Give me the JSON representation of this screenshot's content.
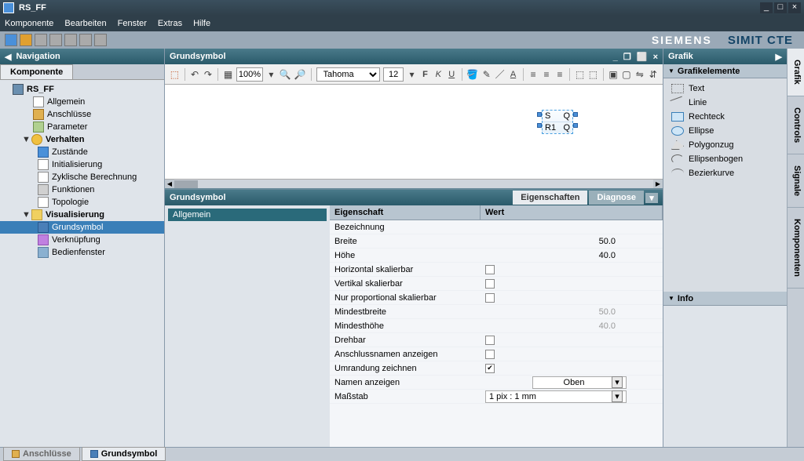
{
  "title": "RS_FF",
  "menu": {
    "komponente": "Komponente",
    "bearbeiten": "Bearbeiten",
    "fenster": "Fenster",
    "extras": "Extras",
    "hilfe": "Hilfe"
  },
  "brand": {
    "siemens": "SIEMENS",
    "product": "SIMIT CTE"
  },
  "nav": {
    "title": "Navigation",
    "tab": "Komponente",
    "root": "RS_FF",
    "items": {
      "allgemein": "Allgemein",
      "anschluesse": "Anschlüsse",
      "parameter": "Parameter",
      "verhalten": "Verhalten",
      "zustaende": "Zustände",
      "initial": "Initialisierung",
      "zyklisch": "Zyklische Berechnung",
      "funktionen": "Funktionen",
      "topologie": "Topologie",
      "visual": "Visualisierung",
      "grundsymbol": "Grundsymbol",
      "verknuepfung": "Verknüpfung",
      "bedien": "Bedienfenster"
    }
  },
  "doc": {
    "title": "Grundsymbol"
  },
  "toolbar": {
    "zoom": "100%",
    "font": "Tahoma",
    "size": "12"
  },
  "symbol": {
    "s": "S",
    "q": "Q",
    "r1": "R1",
    "qn": "Q"
  },
  "props": {
    "title": "Grundsymbol",
    "tabs": {
      "eigen": "Eigenschaften",
      "diag": "Diagnose"
    },
    "nav": {
      "allgemein": "Allgemein"
    },
    "cols": {
      "prop": "Eigenschaft",
      "val": "Wert"
    },
    "rows": {
      "bezeichnung": "Bezeichnung",
      "breite": "Breite",
      "hoehe": "Höhe",
      "hskal": "Horizontal skalierbar",
      "vskal": "Vertikal skalierbar",
      "pskal": "Nur proportional skalierbar",
      "minb": "Mindestbreite",
      "minh": "Mindesthöhe",
      "drehbar": "Drehbar",
      "anschluss": "Anschlussnamen anzeigen",
      "umrandung": "Umrandung zeichnen",
      "namen": "Namen anzeigen",
      "massstab": "Maßstab"
    },
    "vals": {
      "bezeichnung": "",
      "breite": "50.0",
      "hoehe": "40.0",
      "minb": "50.0",
      "minh": "40.0",
      "namen": "Oben",
      "massstab": "1 pix : 1 mm",
      "check": "✔"
    }
  },
  "right": {
    "title": "Grafik",
    "section": "Grafikelemente",
    "items": {
      "text": "Text",
      "linie": "Linie",
      "rechteck": "Rechteck",
      "ellipse": "Ellipse",
      "polygon": "Polygonzug",
      "bogen": "Ellipsenbogen",
      "bezier": "Bezierkurve"
    },
    "info": "Info",
    "tabs": {
      "grafik": "Grafik",
      "controls": "Controls",
      "signale": "Signale",
      "komponenten": "Komponenten"
    }
  },
  "bottom": {
    "anschluesse": "Anschlüsse",
    "grundsymbol": "Grundsymbol"
  }
}
